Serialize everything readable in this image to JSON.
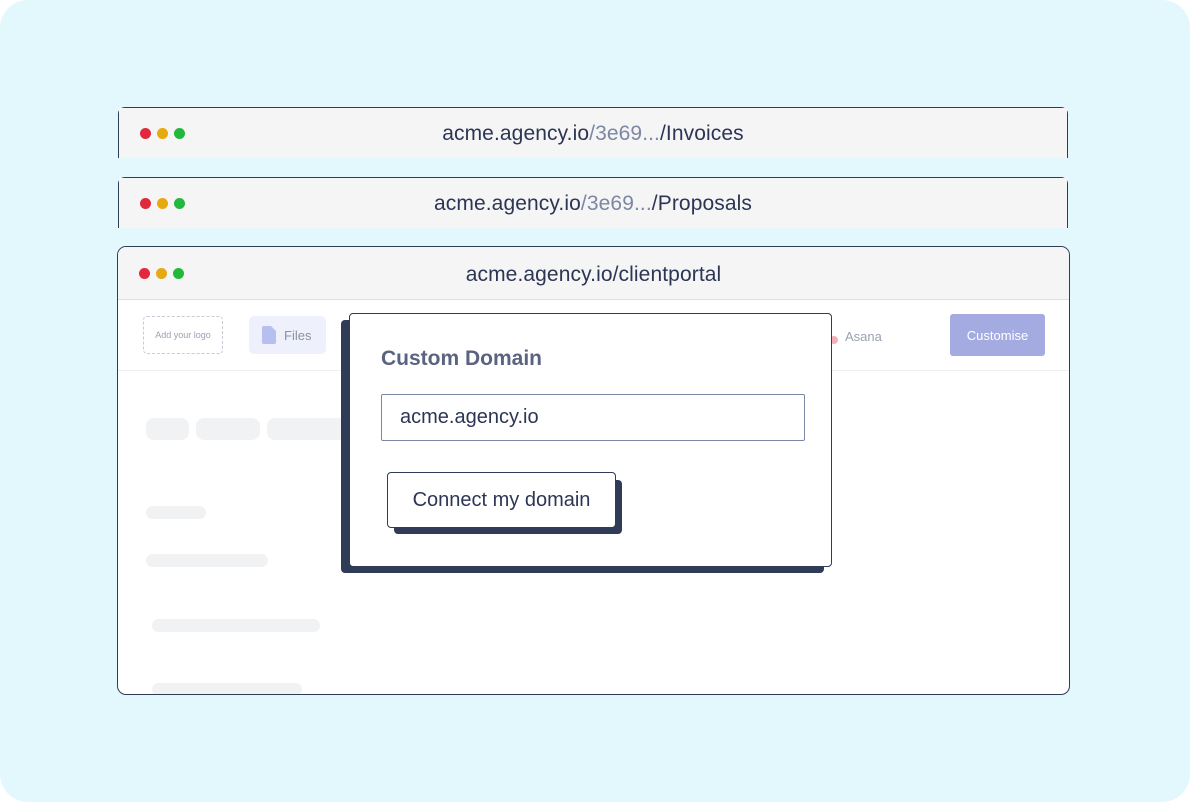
{
  "windows": [
    {
      "url_host": "acme.agency.io",
      "url_mid": "/3e69...",
      "url_tail": "/Invoices"
    },
    {
      "url_host": "acme.agency.io",
      "url_mid": "/3e69...",
      "url_tail": "/Proposals"
    },
    {
      "url_host": "acme.agency.io/clientportal",
      "url_mid": "",
      "url_tail": ""
    }
  ],
  "portal": {
    "logo_placeholder": "Add your logo",
    "files_label": "Files",
    "asana_label": "Asana",
    "customise_label": "Customise"
  },
  "modal": {
    "title": "Custom Domain",
    "domain_value": "acme.agency.io",
    "connect_label": "Connect my domain"
  },
  "colors": {
    "background": "#e3f8fd",
    "window_border": "#2f3b57",
    "accent": "#a4abe1",
    "dot_red": "#e0293d",
    "dot_yellow": "#e6a910",
    "dot_green": "#22b83b"
  }
}
